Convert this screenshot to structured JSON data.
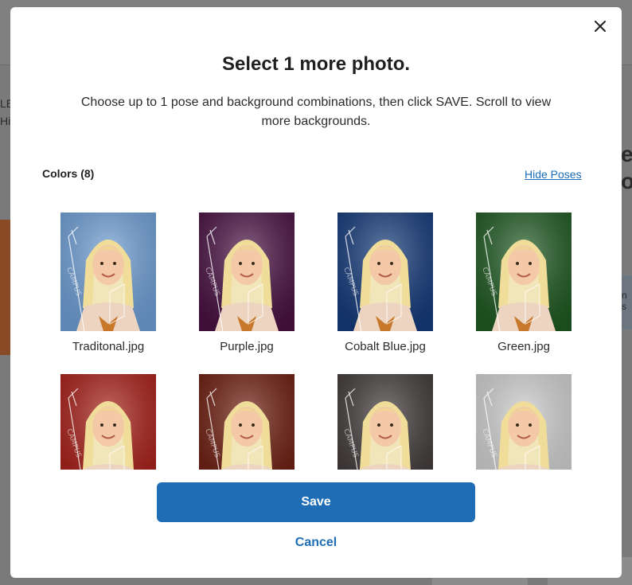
{
  "modal": {
    "title": "Select 1 more photo.",
    "subtitle": "Choose up to 1 pose and background combinations, then click SAVE. Scroll to view more backgrounds.",
    "section_label": "Colors (8)",
    "hide_link": "Hide Poses",
    "save_label": "Save",
    "cancel_label": "Cancel",
    "close_icon": "close-icon"
  },
  "photos": [
    {
      "caption": "Traditonal.jpg",
      "bg": "#6f9fd6"
    },
    {
      "caption": "Purple.jpg",
      "bg": "#4a1244"
    },
    {
      "caption": "Cobalt Blue.jpg",
      "bg": "#143a7a"
    },
    {
      "caption": "Green.jpg",
      "bg": "#1f5a22"
    },
    {
      "caption": "",
      "bg": "#a81e17"
    },
    {
      "caption": "",
      "bg": "#6e1d0f"
    },
    {
      "caption": "",
      "bg": "#403a39"
    },
    {
      "caption": "",
      "bg": "#d0d0d0"
    }
  ],
  "background_page": {
    "text_1": "LE",
    "text_2": "Hig",
    "text_3": "e",
    "text_4": "or",
    "text_5": "n s"
  }
}
